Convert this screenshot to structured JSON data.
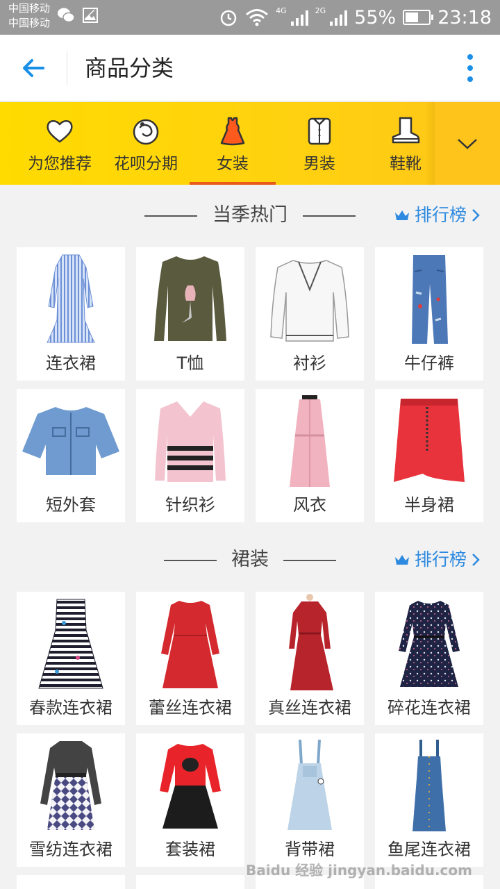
{
  "status_bar": {
    "carrier_1": "中国移动",
    "carrier_2": "中国移动",
    "net_1": "4G",
    "net_2": "2G",
    "battery": "55%",
    "battery_level": 0.55,
    "time": "23:18"
  },
  "header": {
    "title": "商品分类",
    "accent_color": "#1a8fe8"
  },
  "category_tabs": [
    {
      "label": "为您推荐",
      "icon": "heart-icon",
      "active": false
    },
    {
      "label": "花呗分期",
      "icon": "huabei-icon",
      "active": false
    },
    {
      "label": "女装",
      "icon": "dress-icon",
      "active": true
    },
    {
      "label": "男装",
      "icon": "shirt-icon",
      "active": false
    },
    {
      "label": "鞋靴",
      "icon": "boot-icon",
      "active": false
    }
  ],
  "tab_bar_color": "#ffd400",
  "active_underline_color": "#e85a16",
  "sections": [
    {
      "title": "当季热门",
      "ranking_label": "排行榜",
      "items": [
        {
          "label": "连衣裙",
          "icon": "striped-dress-image"
        },
        {
          "label": "T恤",
          "icon": "olive-sweater-image"
        },
        {
          "label": "衬衫",
          "icon": "white-blouse-image"
        },
        {
          "label": "牛仔裤",
          "icon": "jeans-image"
        },
        {
          "label": "短外套",
          "icon": "denim-jacket-image"
        },
        {
          "label": "针织衫",
          "icon": "pink-knit-image"
        },
        {
          "label": "风衣",
          "icon": "pink-coat-dress-image"
        },
        {
          "label": "半身裙",
          "icon": "red-skirt-image"
        }
      ]
    },
    {
      "title": "裙装",
      "ranking_label": "排行榜",
      "items": [
        {
          "label": "春款连衣裙",
          "icon": "striped-print-dress-image"
        },
        {
          "label": "蕾丝连衣裙",
          "icon": "red-lace-dress-image"
        },
        {
          "label": "真丝连衣裙",
          "icon": "red-silk-dress-image"
        },
        {
          "label": "碎花连衣裙",
          "icon": "floral-dress-image"
        },
        {
          "label": "雪纺连衣裙",
          "icon": "chiffon-dress-image"
        },
        {
          "label": "套装裙",
          "icon": "red-black-suit-dress-image"
        },
        {
          "label": "背带裙",
          "icon": "denim-overall-dress-image"
        },
        {
          "label": "鱼尾连衣裙",
          "icon": "denim-pinafore-dress-image"
        }
      ]
    }
  ],
  "watermark": "Baidu 经验 jingyan.baidu.com"
}
